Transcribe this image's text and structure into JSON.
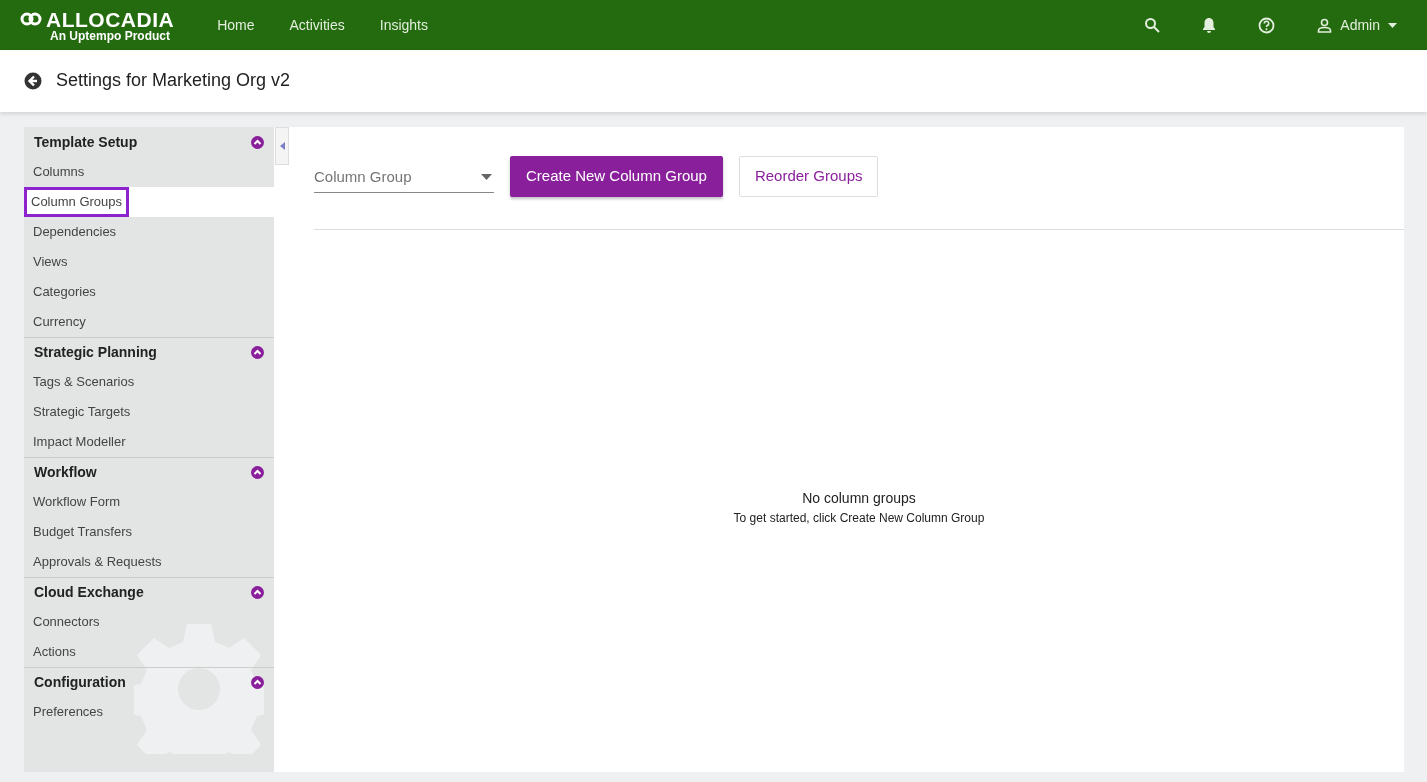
{
  "brand": {
    "name": "ALLOCADIA",
    "tagline": "An Uptempo Product"
  },
  "nav": [
    {
      "label": "Home",
      "selected": false
    },
    {
      "label": "Activities",
      "selected": false
    },
    {
      "label": "Insights",
      "selected": false
    }
  ],
  "user": {
    "name": "Admin"
  },
  "page_title": "Settings for Marketing Org v2",
  "sidebar": [
    {
      "title": "Template Setup",
      "expanded": true,
      "items": [
        {
          "label": "Columns",
          "selected": false
        },
        {
          "label": "Column Groups",
          "selected": true
        },
        {
          "label": "Dependencies",
          "selected": false
        },
        {
          "label": "Views",
          "selected": false
        },
        {
          "label": "Categories",
          "selected": false
        },
        {
          "label": "Currency",
          "selected": false
        }
      ]
    },
    {
      "title": "Strategic Planning",
      "expanded": true,
      "items": [
        {
          "label": "Tags & Scenarios",
          "selected": false
        },
        {
          "label": "Strategic Targets",
          "selected": false
        },
        {
          "label": "Impact Modeller",
          "selected": false
        }
      ]
    },
    {
      "title": "Workflow",
      "expanded": true,
      "items": [
        {
          "label": "Workflow Form",
          "selected": false
        },
        {
          "label": "Budget Transfers",
          "selected": false
        },
        {
          "label": "Approvals & Requests",
          "selected": false
        }
      ]
    },
    {
      "title": "Cloud Exchange",
      "expanded": true,
      "items": [
        {
          "label": "Connectors",
          "selected": false
        },
        {
          "label": "Actions",
          "selected": false
        }
      ]
    },
    {
      "title": "Configuration",
      "expanded": true,
      "items": [
        {
          "label": "Preferences",
          "selected": false
        }
      ]
    }
  ],
  "toolbar": {
    "select": {
      "placeholder": "Column Group"
    },
    "buttons": [
      {
        "label": "Create New Column Group",
        "kind": "primary"
      },
      {
        "label": "Reorder Groups",
        "kind": "outline"
      }
    ]
  },
  "empty_state": {
    "title": "No column groups",
    "hint": "To get started, click Create New Column Group"
  }
}
